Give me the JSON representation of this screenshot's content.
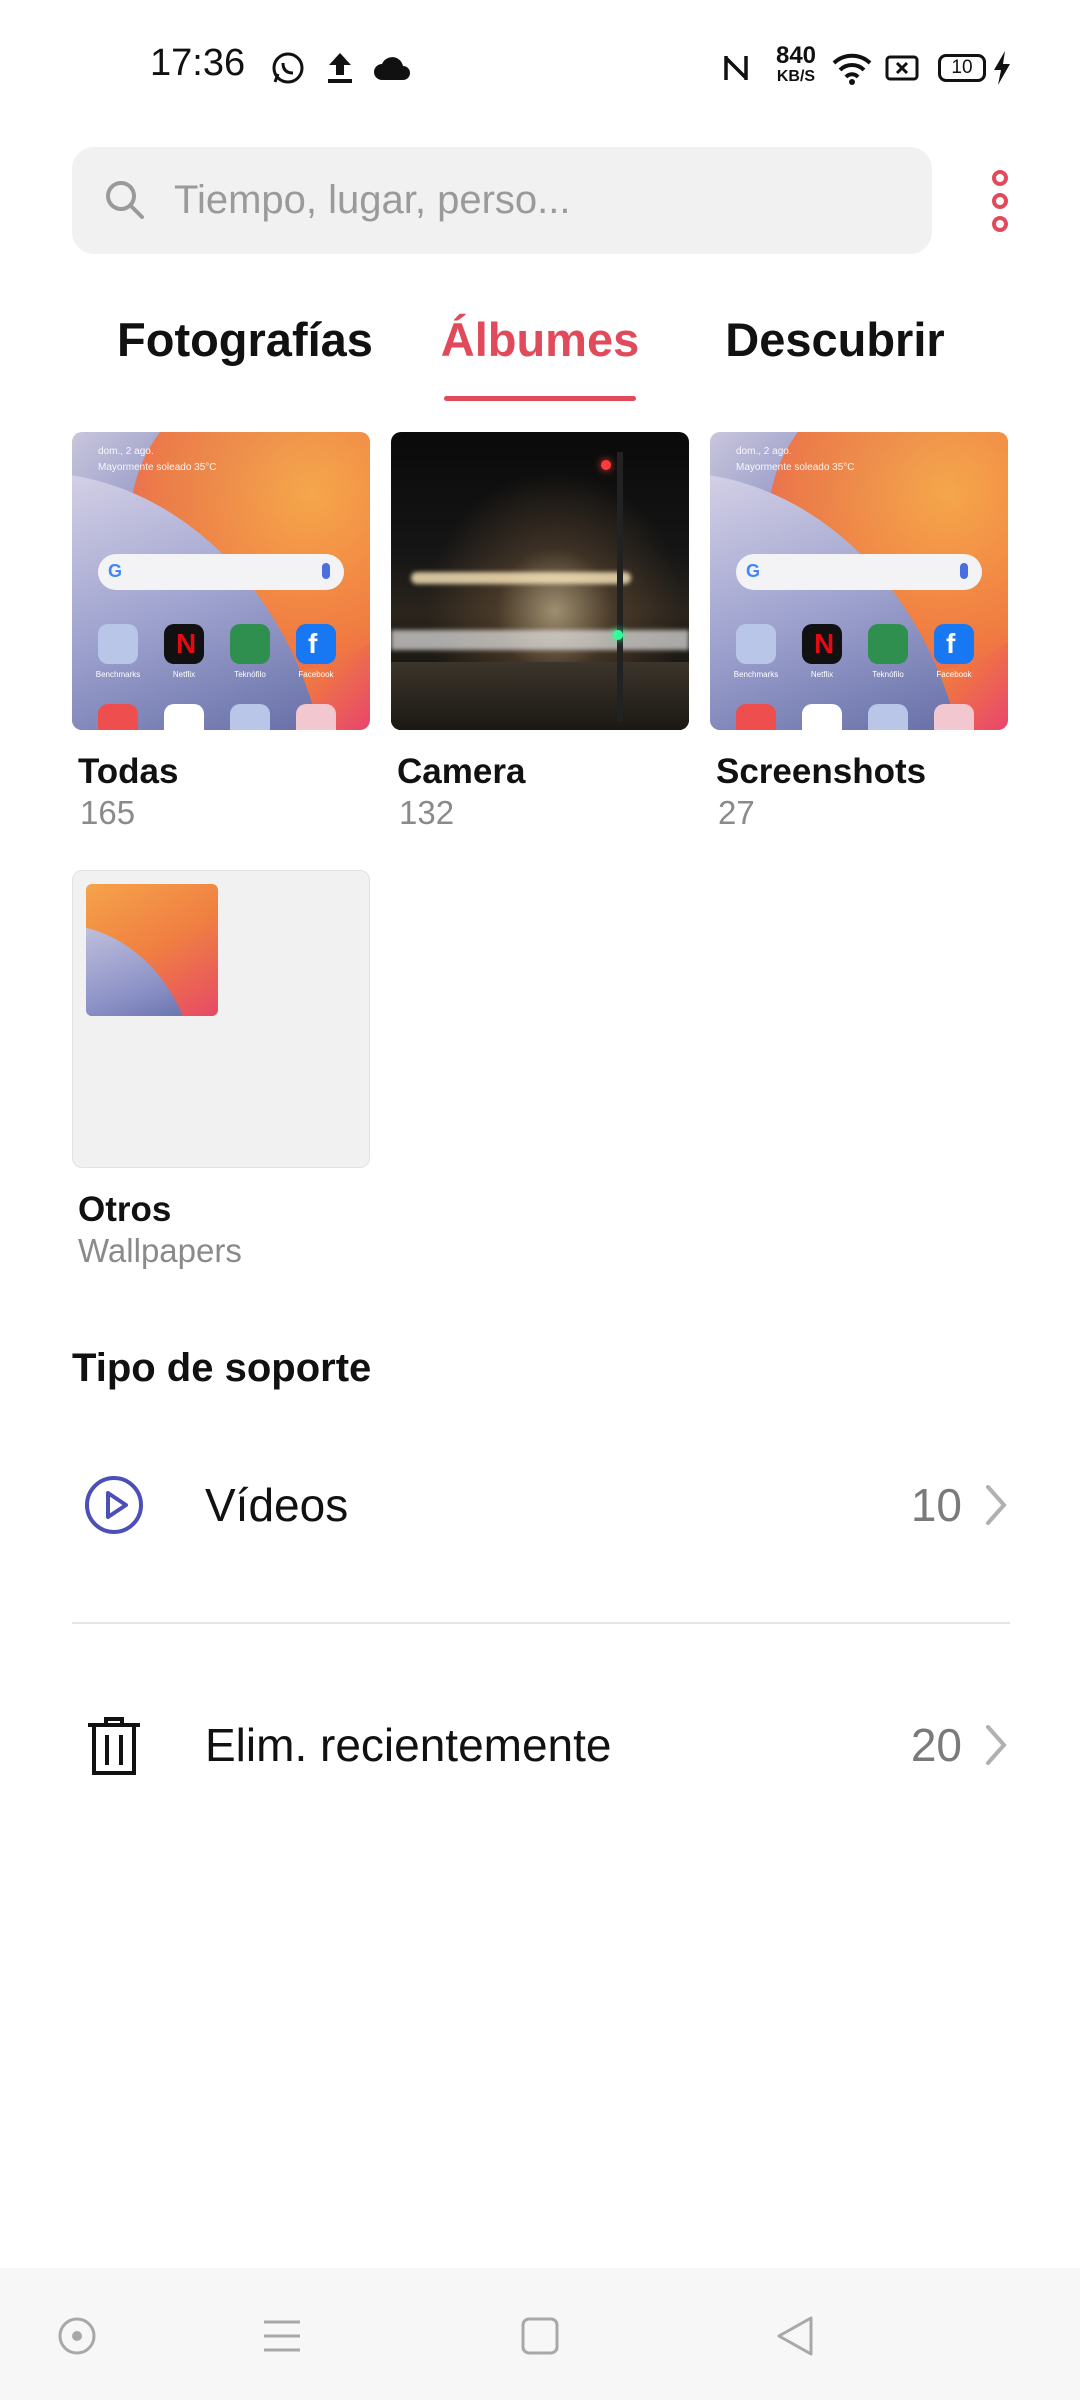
{
  "status_bar": {
    "time": "17:36",
    "net_speed_value": "840",
    "net_speed_unit": "KB/S",
    "battery": "10",
    "icons": [
      "whatsapp-icon",
      "upload-icon",
      "cloud-icon",
      "nfc-icon",
      "wifi-icon",
      "sim-icon",
      "battery-icon",
      "charging-icon"
    ]
  },
  "search": {
    "placeholder": "Tiempo, lugar, perso..."
  },
  "tabs": [
    {
      "label": "Fotografías",
      "active": false
    },
    {
      "label": "Álbumes",
      "active": true
    },
    {
      "label": "Descubrir",
      "active": false
    }
  ],
  "albums": [
    {
      "name": "Todas",
      "count": "165"
    },
    {
      "name": "Camera",
      "count": "132"
    },
    {
      "name": "Screenshots",
      "count": "27"
    },
    {
      "name": "Otros",
      "count": "Wallpapers"
    }
  ],
  "thumb_text": {
    "date": "dom., 2 ago.",
    "weather": "Mayormente soleado 35°C",
    "apps": [
      "Benchmarks",
      "Netflix",
      "Teknófilo",
      "Facebook"
    ]
  },
  "media_section": {
    "title": "Tipo de soporte",
    "items": [
      {
        "label": "Vídeos",
        "count": "10",
        "icon": "play-circle-icon"
      },
      {
        "label": "Elim. recientemente",
        "count": "20",
        "icon": "trash-icon"
      }
    ]
  },
  "colors": {
    "accent": "#e14a5a",
    "video_icon": "#4b4fb8"
  }
}
